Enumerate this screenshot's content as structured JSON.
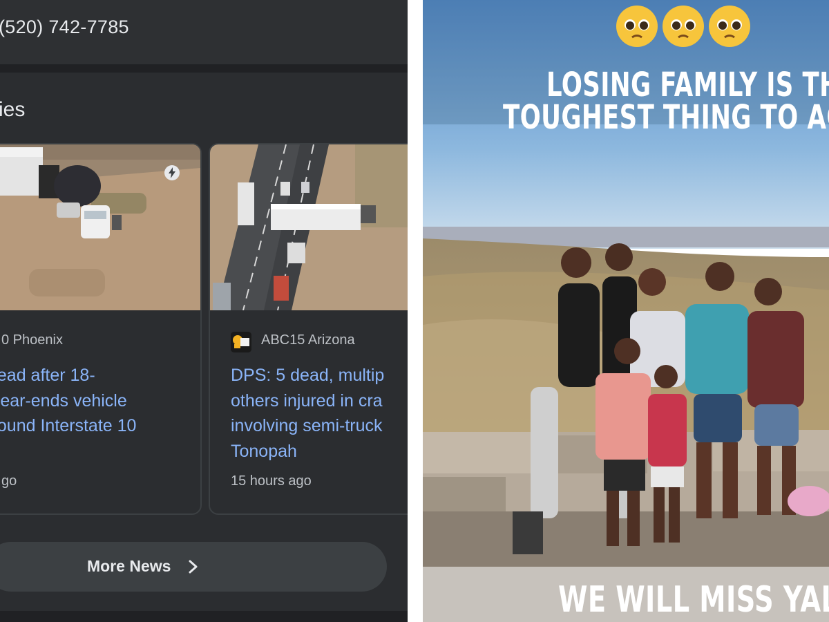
{
  "contact": {
    "phone": "(520) 742-7785"
  },
  "section": {
    "title": "ies"
  },
  "stories": [
    {
      "source": "0 Phoenix",
      "headline_lines": [
        "dead after 18-",
        "rear-ends vehicle",
        "bound Interstate 10"
      ],
      "time": "go",
      "icon": "amp-bolt-icon"
    },
    {
      "source": "ABC15 Arizona",
      "headline_lines": [
        "DPS: 5 dead, multip",
        "others injured in cra",
        "involving semi-truck",
        "Tonopah"
      ],
      "time": "15 hours ago",
      "icon": "abc15-logo-icon"
    }
  ],
  "more_news": {
    "label": "More News",
    "icon": "chevron-right-icon"
  },
  "photo": {
    "emoji": [
      "🥺",
      "🥺",
      "🥺"
    ],
    "caption_lines": [
      "LOSING FAMILY IS THE",
      "TOUGHEST THING TO ACCE"
    ],
    "bottom_caption": "WE WILL MISS YALL"
  },
  "colors": {
    "background": "#2b2d30",
    "headline_link": "#8ab4f8",
    "secondary_text": "#bdc1c6",
    "primary_text": "#e8eaed"
  }
}
